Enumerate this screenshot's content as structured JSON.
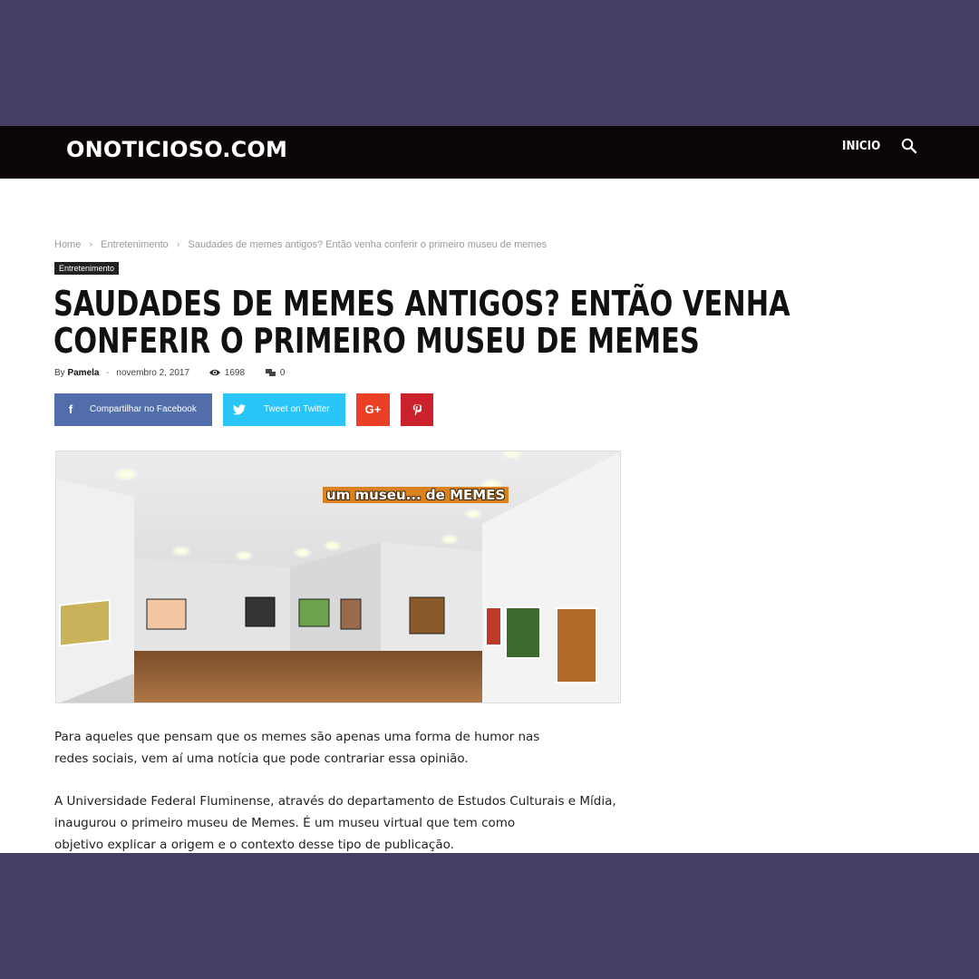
{
  "header": {
    "logo": "ONOTICIOSO.COM",
    "nav_item": "INICIO",
    "search_icon": "search-icon"
  },
  "breadcrumb": {
    "home": "Home",
    "category": "Entretenimento",
    "current": "Saudades de memes antigos? Então venha conferir o primeiro museu de memes"
  },
  "article": {
    "category_tag": "Entretenimento",
    "title_line1": "SAUDADES DE MEMES ANTIGOS? ENTÃO VENHA",
    "title_line2": "CONFERIR O PRIMEIRO MUSEU DE MEMES",
    "by": "By",
    "author": "Pamela",
    "separator": "-",
    "date": "novembro 2, 2017",
    "views": "1698",
    "comments": "0",
    "image_caption": "um museu... de MEMES",
    "para1_line1": "Para aqueles que pensam que os memes são apenas uma forma de humor nas",
    "para1_line2": "redes sociais, vem aí uma notícia que pode contrariar essa opinião.",
    "para2_line1": "A Universidade Federal Fluminense, através do departamento de Estudos Culturais e Mídia,",
    "para2_line2": "inaugurou o primeiro museu de Memes. É um museu virtual que tem como",
    "para2_line3": "objetivo explicar a origem e o contexto desse tipo de publicação."
  },
  "share": {
    "facebook_label": "Compartilhar no Facebook",
    "twitter_label": "Tweet on Twitter",
    "googleplus_glyph": "G+",
    "facebook_glyph": "f"
  },
  "colors": {
    "frame_background": "#453d63",
    "topbar": "#0b0505",
    "facebook": "#516eab",
    "twitter": "#29c5f6",
    "googleplus": "#eb4026",
    "pinterest": "#ca212a"
  }
}
